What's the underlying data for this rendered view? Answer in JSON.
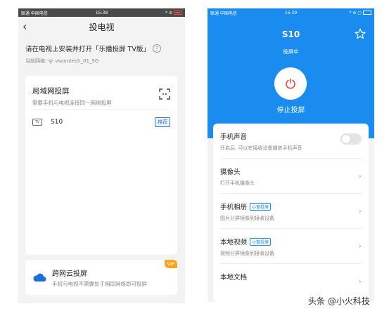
{
  "colors": {
    "accent_blue": "#1a8cf0",
    "vip_orange": "#f5a623",
    "bg_gray": "#f3f3f3"
  },
  "left": {
    "status": {
      "carrier": "联通 中国电信 ",
      "time": "15:38",
      "right": "* ⊘"
    },
    "nav": {
      "back_icon": "chevron-left-icon",
      "title": "投电视"
    },
    "prompt": {
      "text": "请在电视上安装并打开「乐播投屏 TV版」",
      "help_icon": "question-circle-icon",
      "network_label": "当前网络: ",
      "network_name": "vsoontech_01_5G"
    },
    "lan": {
      "title": "局域网投屏",
      "subtitle": "需要手机与电视连接同一网络投屏",
      "scan_icon": "scan-icon",
      "device": {
        "icon_text": "TV",
        "name": "S10",
        "badge": "推荐"
      }
    },
    "cloud": {
      "title": "跨网云投屏",
      "subtitle": "手机与电视不需要处于相同网络即可投屏",
      "vip": "VIP"
    }
  },
  "right": {
    "status": {
      "carrier": "联通 中国电信 ",
      "time": "15:39",
      "right": "* ⊘ ▢"
    },
    "device_name": "S10",
    "casting_status": "投屏中",
    "stop_label": "停止投屏",
    "settings": [
      {
        "title": "手机声音",
        "subtitle": "开启后, 可以在接收设备播放手机声音",
        "control": "toggle"
      },
      {
        "title": "摄像头",
        "subtitle": "打开手机摄像头",
        "control": "chevron"
      },
      {
        "title": "手机相册",
        "tag": "小窗投屏",
        "subtitle": "图片分屏镜像到接收设备",
        "control": "chevron"
      },
      {
        "title": "本地视频",
        "tag": "小窗投屏",
        "subtitle": "视频分屏镜像到接收设备",
        "control": "chevron"
      },
      {
        "title": "本地文档",
        "subtitle": "",
        "control": "chevron"
      }
    ]
  },
  "watermark": "头条 @小火科技"
}
